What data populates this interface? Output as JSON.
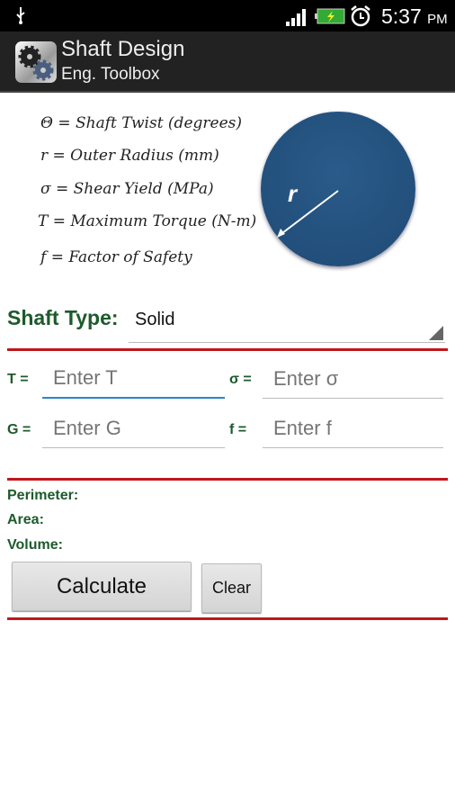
{
  "status_bar": {
    "time": "5:37",
    "ampm": "PM",
    "icons": [
      "usb-icon",
      "signal-icon",
      "battery-charging-icon",
      "alarm-icon"
    ]
  },
  "app_bar": {
    "title": "Shaft Design",
    "subtitle": "Eng. Toolbox",
    "icon": "gears-icon"
  },
  "legend": [
    "Θ = Shaft Twist (degrees)",
    "r = Outer Radius (mm)",
    "σ = Shear Yield (MPa)",
    "T = Maximum Torque (N-m)",
    "f = Factor of Safety"
  ],
  "diagram": {
    "radius_label": "r",
    "color": "#24527f"
  },
  "shaft_type": {
    "label": "Shaft Type:",
    "value": "Solid"
  },
  "inputs": {
    "T": {
      "label": "T =",
      "placeholder": "Enter T"
    },
    "sigma": {
      "label": "σ =",
      "placeholder": "Enter σ"
    },
    "G": {
      "label": "G =",
      "placeholder": "Enter G"
    },
    "f": {
      "label": "f =",
      "placeholder": "Enter f"
    }
  },
  "results": {
    "perimeter": "Perimeter:",
    "area": "Area:",
    "volume": "Volume:"
  },
  "buttons": {
    "calculate": "Calculate",
    "clear": "Clear"
  },
  "colors": {
    "accent_red": "#c0171b",
    "label_green": "#1d5a2c",
    "focus_blue": "#2a86c6"
  }
}
